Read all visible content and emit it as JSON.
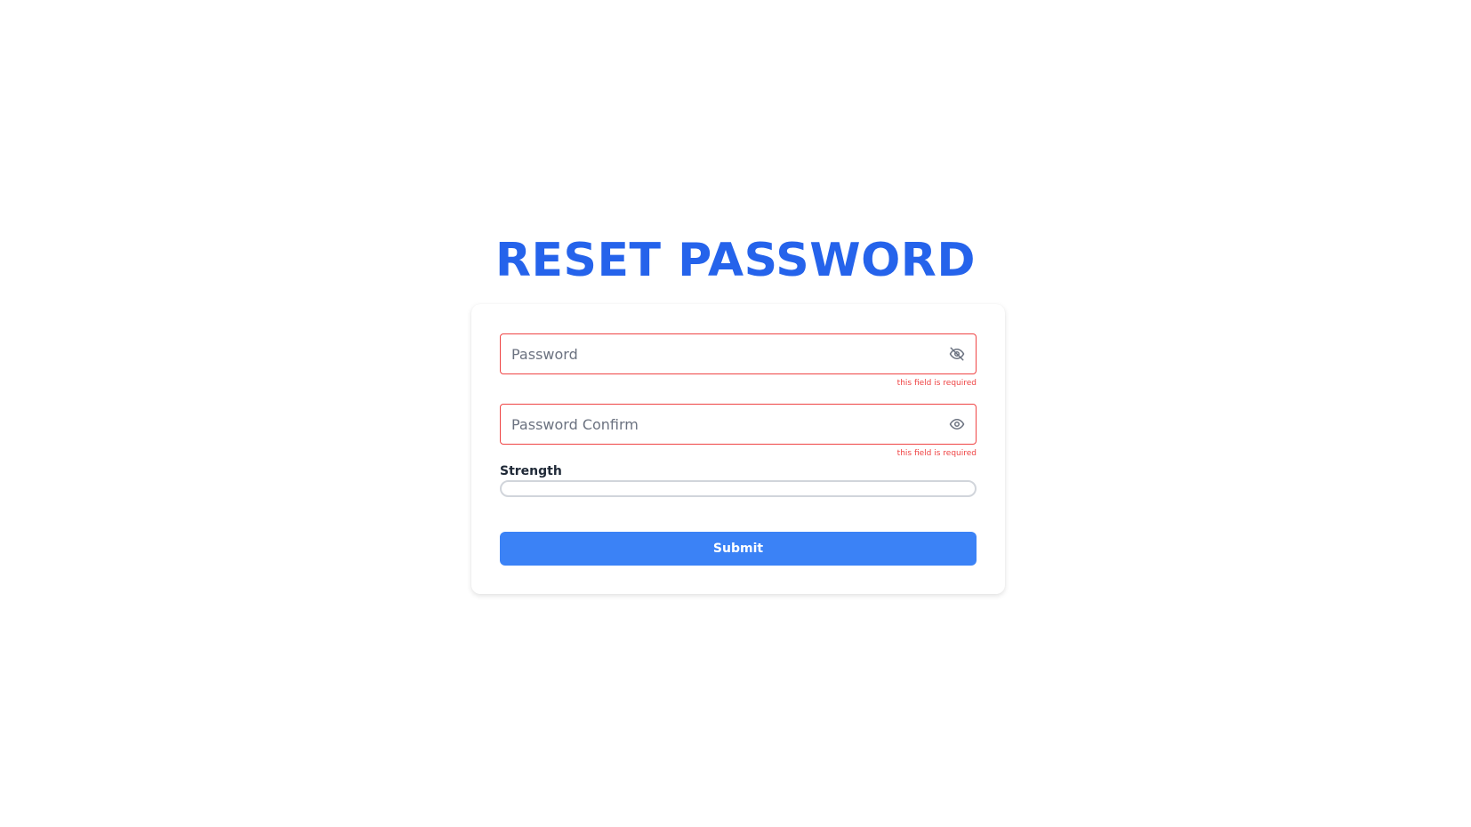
{
  "page": {
    "title": "RESET PASSWORD"
  },
  "form": {
    "password": {
      "placeholder": "Password",
      "value": "",
      "error": "this field is required",
      "toggle_icon": "eye-off-icon"
    },
    "password_confirm": {
      "placeholder": "Password Confirm",
      "value": "",
      "error": "this field is required",
      "toggle_icon": "eye-icon"
    },
    "strength": {
      "label": "Strength",
      "level": 0
    },
    "submit_label": "Submit"
  },
  "colors": {
    "title": "#2563eb",
    "error": "#ef4444",
    "submit": "#3b82f6"
  }
}
